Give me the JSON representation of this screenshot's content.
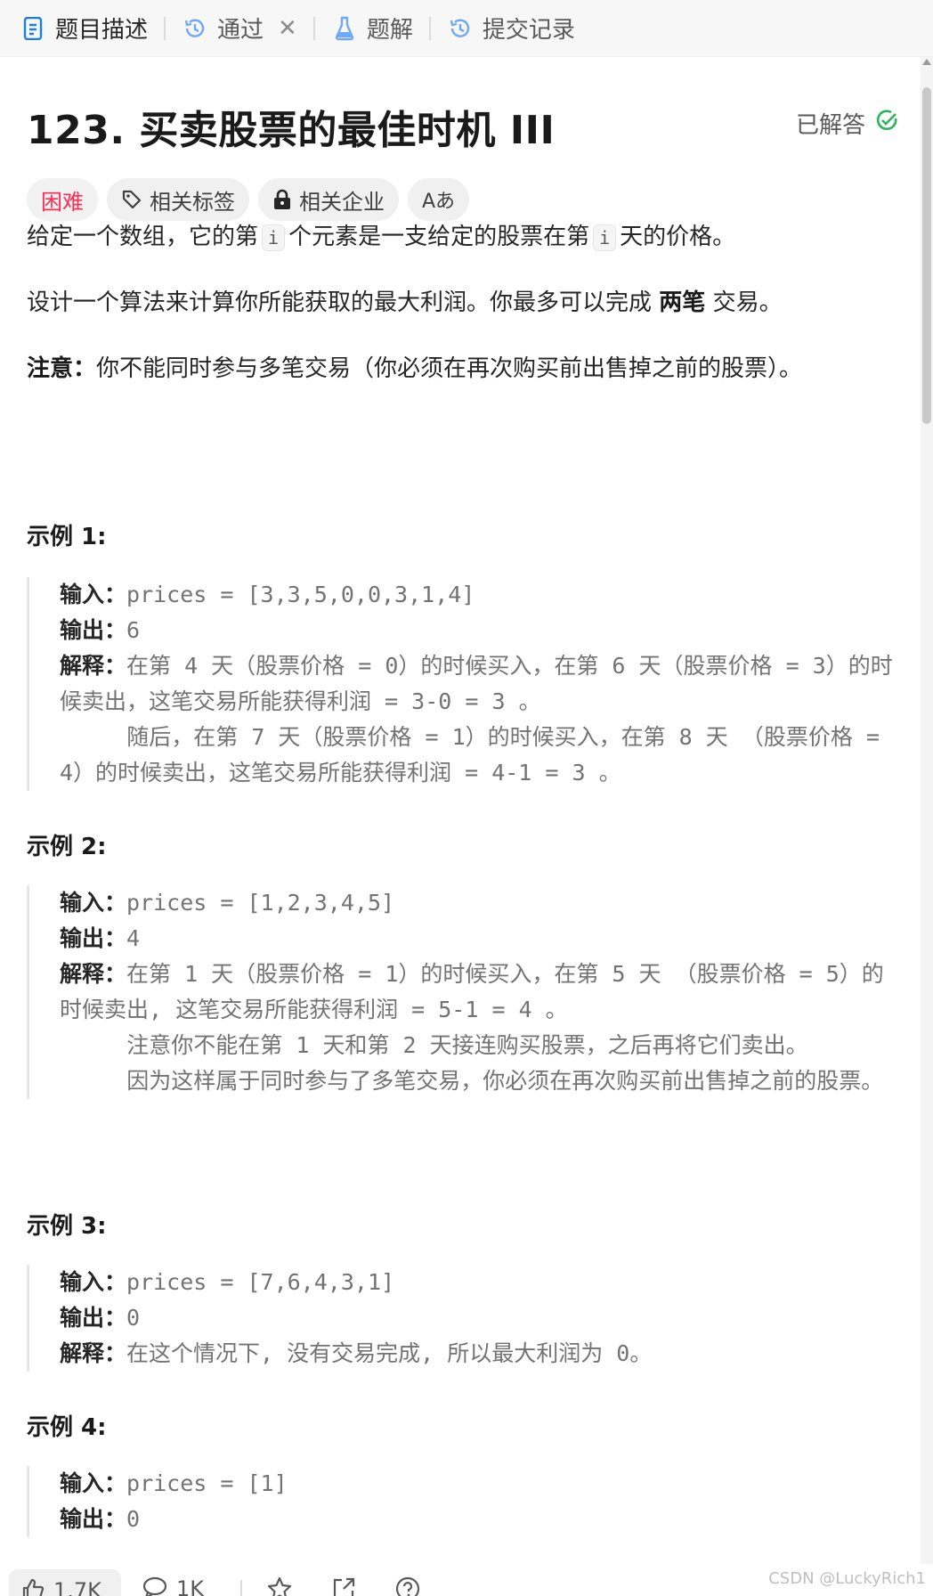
{
  "tabs": [
    {
      "label": "题目描述",
      "icon": "document-icon",
      "active": true
    },
    {
      "label": "通过",
      "icon": "history-icon",
      "closable": true
    },
    {
      "label": "题解",
      "icon": "flask-icon"
    },
    {
      "label": "提交记录",
      "icon": "history-icon"
    }
  ],
  "problem": {
    "title": "123. 买卖股票的最佳时机 III",
    "status": "已解答",
    "status_color": "#2db55d",
    "difficulty": "困难",
    "difficulty_color": "#ff2d55",
    "chips": {
      "tags": "相关标签",
      "companies": "相关企业",
      "font_toggle": "Aあ"
    },
    "desc1_a": "给定一个数组，它的第",
    "desc1_code1": "i",
    "desc1_b": "个元素是一支给定的股票在第",
    "desc1_code2": "i",
    "desc1_c": "天的价格。",
    "desc2_a": "设计一个算法来计算你所能获取的最大利润。你最多可以完成",
    "desc2_bold": "两笔",
    "desc2_b": "交易。",
    "note_label": "注意：",
    "note_text": "你不能同时参与多笔交易（你必须在再次购买前出售掉之前的股票）。"
  },
  "examples": [
    {
      "title": "示例 1:",
      "input_label": "输入：",
      "input": "prices = [3,3,5,0,0,3,1,4]",
      "output_label": "输出：",
      "output": "6",
      "explain_label": "解释：",
      "explain": "在第 4 天（股票价格 = 0）的时候买入，在第 6 天（股票价格 = 3）的时候卖出，这笔交易所能获得利润 = 3-0 = 3 。\n     随后，在第 7 天（股票价格 = 1）的时候买入，在第 8 天 （股票价格 = 4）的时候卖出，这笔交易所能获得利润 = 4-1 = 3 。"
    },
    {
      "title": "示例 2:",
      "input_label": "输入：",
      "input": "prices = [1,2,3,4,5]",
      "output_label": "输出：",
      "output": "4",
      "explain_label": "解释：",
      "explain": "在第 1 天（股票价格 = 1）的时候买入，在第 5 天 （股票价格 = 5）的时候卖出, 这笔交易所能获得利润 = 5-1 = 4 。\n     注意你不能在第 1 天和第 2 天接连购买股票，之后再将它们卖出。\n     因为这样属于同时参与了多笔交易，你必须在再次购买前出售掉之前的股票。"
    },
    {
      "title": "示例 3:",
      "input_label": "输入：",
      "input": "prices = [7,6,4,3,1]",
      "output_label": "输出：",
      "output": "0",
      "explain_label": "解释：",
      "explain": "在这个情况下, 没有交易完成, 所以最大利润为 0。"
    },
    {
      "title": "示例 4:",
      "input_label": "输入：",
      "input": "prices = [1]",
      "output_label": "输出：",
      "output": "0"
    }
  ],
  "footer": {
    "likes": "1.7K",
    "comments": "1K",
    "watermark": "CSDN @LuckyRich1"
  }
}
